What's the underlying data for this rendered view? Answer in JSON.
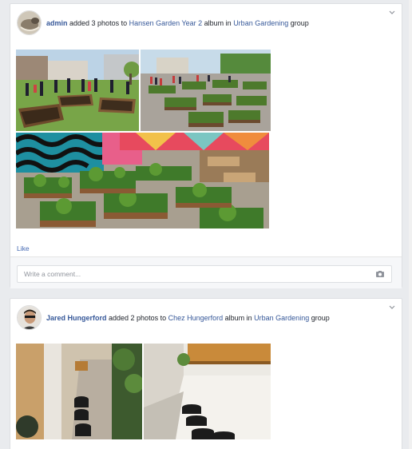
{
  "posts": [
    {
      "author": "admin",
      "action_text": " added 3 photos to ",
      "album": "Hansen Garden Year 2",
      "mid_text": " album in ",
      "group": "Urban Gardening",
      "end_text": " group",
      "like_label": "Like",
      "comment_placeholder": "Write a comment...",
      "photos": [
        "garden-kids-photo",
        "garden-beds-crowd-photo",
        "garden-mural-beds-photo"
      ]
    },
    {
      "author": "Jared Hungerford",
      "action_text": " added 2 photos to ",
      "album": "Chez Hungerford",
      "mid_text": " album in ",
      "group": "Urban Gardening",
      "end_text": " group",
      "photos": [
        "alley-pots-photo",
        "patio-pots-photo"
      ]
    }
  ],
  "icons": {
    "menu_caret": "chevron-down-icon",
    "camera": "camera-icon"
  },
  "colors": {
    "link": "#365899",
    "like": "#4267b2",
    "background": "#e9ebee"
  }
}
